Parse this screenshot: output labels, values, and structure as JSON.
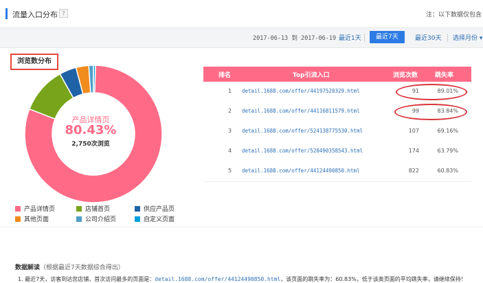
{
  "header": {
    "title": "流量入口分布",
    "help": "?",
    "note": "注：以下数据仅包含"
  },
  "filter": {
    "date_from": "2017-06-13",
    "date_sep": "到",
    "date_to": "2017-06-19",
    "options": [
      {
        "label": "最近1天",
        "active": false
      },
      {
        "label": "最近7天",
        "active": true
      },
      {
        "label": "最近30天",
        "active": false
      },
      {
        "label": "选择月份 ▾",
        "active": false
      }
    ]
  },
  "distribution": {
    "label": "浏览数分布",
    "center_name": "产品详情页",
    "center_pct": "80.43%",
    "center_views": "2,750次浏览"
  },
  "chart_data": {
    "type": "pie",
    "title": "浏览数分布",
    "categories": [
      "产品详情页",
      "店铺首页",
      "供应产品页",
      "其他页面",
      "公司介绍页",
      "自定义页面"
    ],
    "values": [
      80.43,
      11.0,
      4.0,
      3.0,
      1.1,
      0.47
    ],
    "colors": [
      "#ff6b87",
      "#78a41c",
      "#1f62a6",
      "#f08b1d",
      "#4f9fc9",
      "#00a0dc"
    ],
    "legend": "bottom"
  },
  "legend": [
    {
      "label": "产品详情页",
      "color": "#ff6b87"
    },
    {
      "label": "店铺首页",
      "color": "#78a41c"
    },
    {
      "label": "供应产品页",
      "color": "#1f62a6"
    },
    {
      "label": "其他页面",
      "color": "#f08b1d"
    },
    {
      "label": "公司介绍页",
      "color": "#4f9fc9"
    },
    {
      "label": "自定义页面",
      "color": "#00a0dc"
    }
  ],
  "table": {
    "headers": {
      "rank": "排名",
      "entry": "Top引流入口",
      "views": "浏览次数",
      "bounce": "跳失率"
    },
    "rows": [
      {
        "rank": "1",
        "link": "detail.1688.com/offer/44197520329.html",
        "views": "91",
        "bounce": "89.01%"
      },
      {
        "rank": "2",
        "link": "detail.1688.com/offer/44116811579.html",
        "views": "99",
        "bounce": "83.84%"
      },
      {
        "rank": "3",
        "link": "detail.1688.com/offer/524138775530.html",
        "views": "107",
        "bounce": "69.16%"
      },
      {
        "rank": "4",
        "link": "detail.1688.com/offer/520490358543.html",
        "views": "174",
        "bounce": "63.79%"
      },
      {
        "rank": "5",
        "link": "detail.1688.com/offer/44124490850.html",
        "views": "822",
        "bounce": "60.83%"
      }
    ]
  },
  "interpretation": {
    "title": "数据解读",
    "subtitle": "（根据最近7天数据综合得出）",
    "line_prefix": "1. 最近7天，访客到达您店铺，首次访问最多的页面是：",
    "line_link": "detail.1688.com/offer/44124490850.html",
    "line_suffix": "，该页面的跳失率为：60.83%，低于该类页面的平均跳失率，请继续保持！"
  }
}
